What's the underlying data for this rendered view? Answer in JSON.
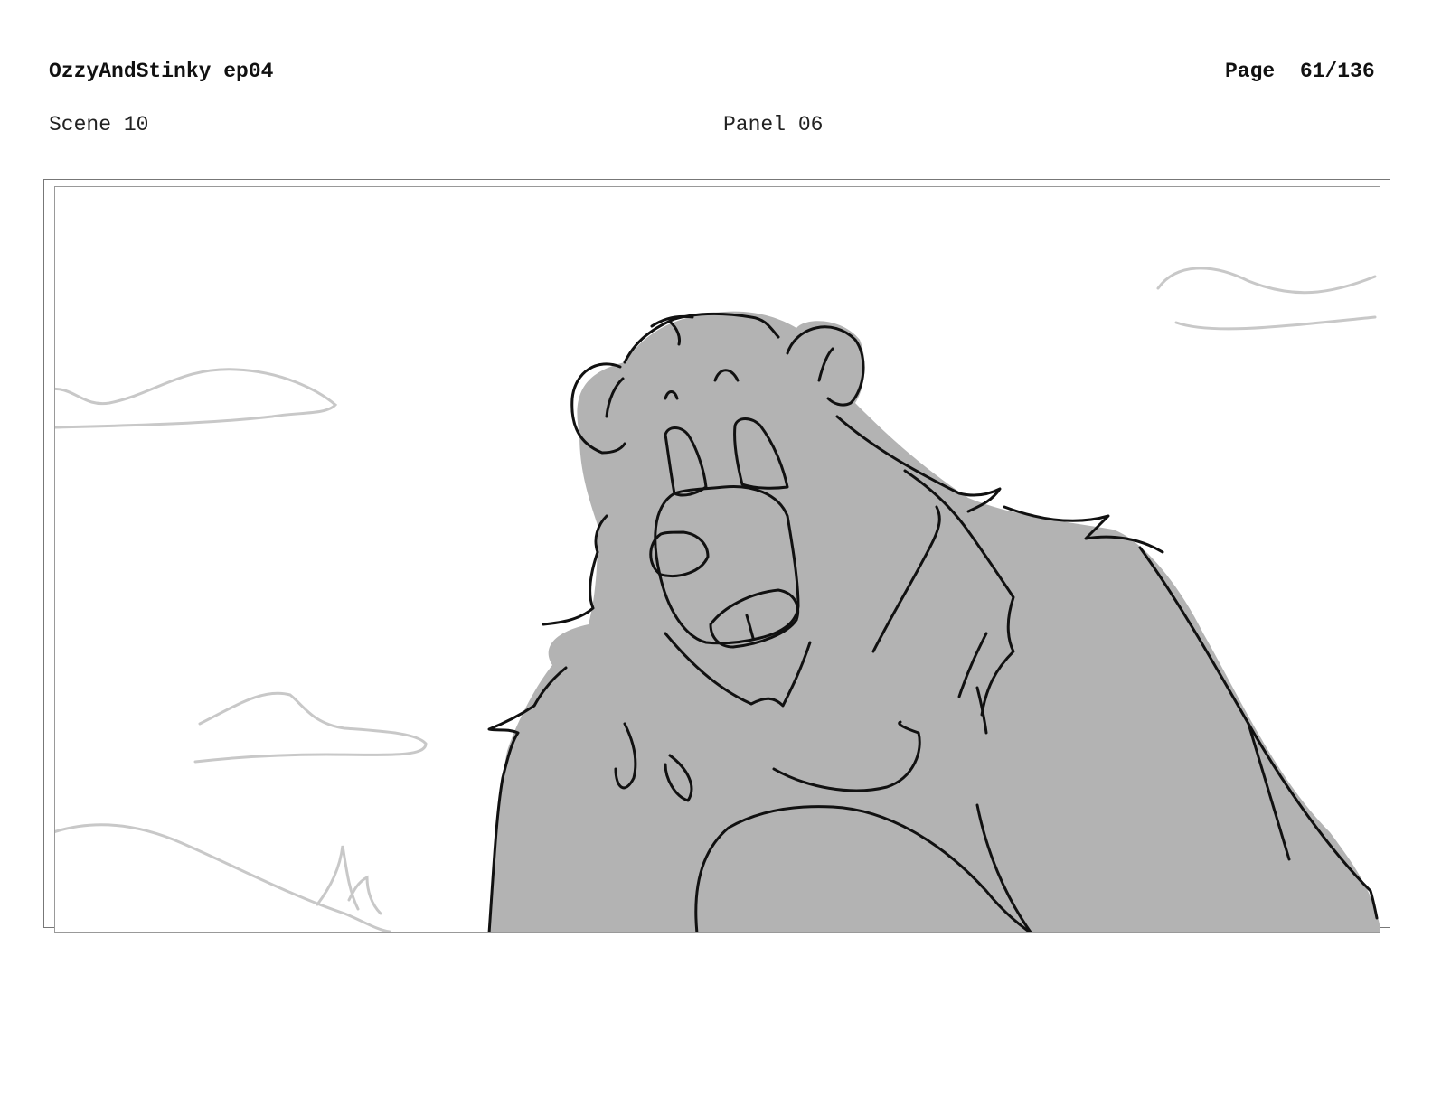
{
  "header": {
    "title": "OzzyAndStinky ep04",
    "page_label": "Page",
    "page_number": "61/136",
    "scene": "Scene 10",
    "panel": "Panel 06"
  },
  "artwork": {
    "subject": "bear-character-sketch",
    "fill_color": "#b3b3b3",
    "line_color": "#111111",
    "background_line_color": "#c8c8c8"
  }
}
